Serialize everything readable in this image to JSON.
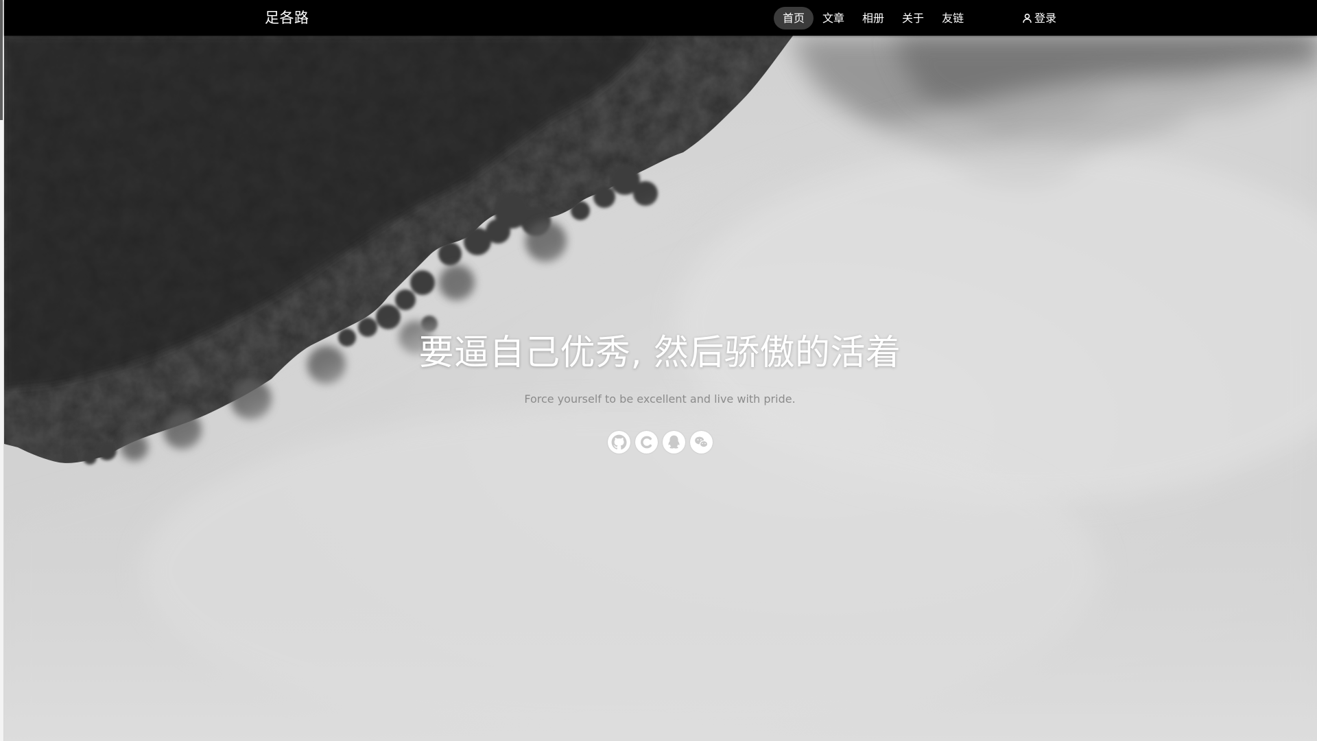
{
  "header": {
    "brand": "足各路",
    "nav": [
      {
        "label": "首页",
        "active": true
      },
      {
        "label": "文章",
        "active": false
      },
      {
        "label": "相册",
        "active": false
      },
      {
        "label": "关于",
        "active": false
      },
      {
        "label": "友链",
        "active": false
      }
    ],
    "login_label": "登录",
    "login_icon": "user-icon"
  },
  "hero": {
    "title": "要逼自己优秀, 然后骄傲的活着",
    "subtitle": "Force yourself to be excellent and live with pride.",
    "social_icons": [
      "github-icon",
      "csdn-icon",
      "qq-icon",
      "wechat-icon"
    ]
  },
  "colors": {
    "topbar": "#000000",
    "nav_active": "#3b3b3b",
    "hero_text": "#ffffff",
    "subtitle_text": "#8b8b8b"
  }
}
